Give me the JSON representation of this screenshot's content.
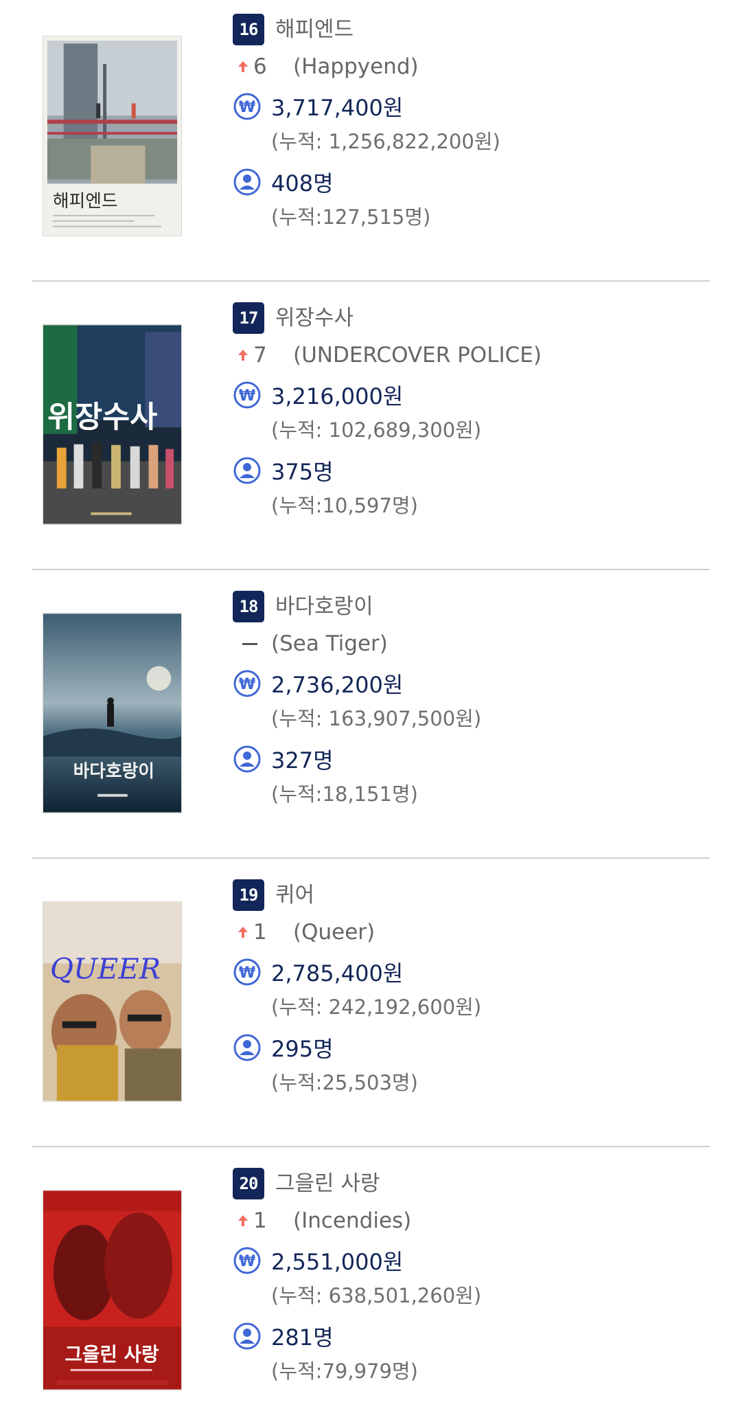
{
  "colors": {
    "badge_bg": "#132659",
    "up_arrow": "#f26f5f",
    "value_text": "#132659",
    "secondary_text": "#666666",
    "icon_blue": "#3f67d6"
  },
  "movies": [
    {
      "rank": "16",
      "change_direction": "up",
      "change": "6",
      "title_ko": "해피엔드",
      "title_en": "(Happyend)",
      "sales": "3,717,400원",
      "sales_cumulative": "(누적: 1,256,822,200원)",
      "audience": "408명",
      "audience_cumulative": "(누적:127,515명)",
      "poster_title": "해피엔드"
    },
    {
      "rank": "17",
      "change_direction": "up",
      "change": "7",
      "title_ko": "위장수사",
      "title_en": "(UNDERCOVER POLICE)",
      "sales": "3,216,000원",
      "sales_cumulative": "(누적: 102,689,300원)",
      "audience": "375명",
      "audience_cumulative": "(누적:10,597명)",
      "poster_title": "위장수사"
    },
    {
      "rank": "18",
      "change_direction": "none",
      "change": "",
      "title_ko": "바다호랑이",
      "title_en": "(Sea Tiger)",
      "sales": "2,736,200원",
      "sales_cumulative": "(누적: 163,907,500원)",
      "audience": "327명",
      "audience_cumulative": "(누적:18,151명)",
      "poster_title": "바다호랑이"
    },
    {
      "rank": "19",
      "change_direction": "up",
      "change": "1",
      "title_ko": "퀴어",
      "title_en": "(Queer)",
      "sales": "2,785,400원",
      "sales_cumulative": "(누적: 242,192,600원)",
      "audience": "295명",
      "audience_cumulative": "(누적:25,503명)",
      "poster_title": "QUEER"
    },
    {
      "rank": "20",
      "change_direction": "up",
      "change": "1",
      "title_ko": "그을린 사랑",
      "title_en": "(Incendies)",
      "sales": "2,551,000원",
      "sales_cumulative": "(누적: 638,501,260원)",
      "audience": "281명",
      "audience_cumulative": "(누적:79,979명)",
      "poster_title": "그을린 사랑"
    }
  ]
}
